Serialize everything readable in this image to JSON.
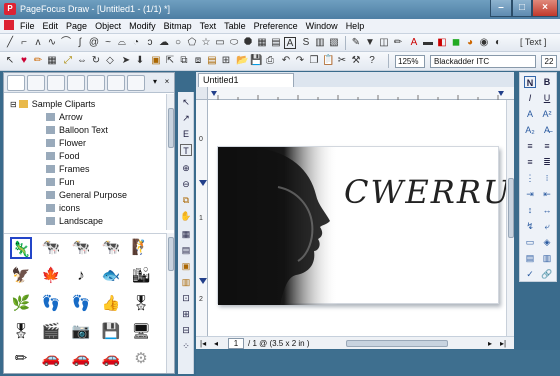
{
  "window": {
    "title": "PageFocus Draw - [Untitled1 - (1/1) *]",
    "min": "–",
    "max": "□",
    "close": "×"
  },
  "menu": [
    "File",
    "Edit",
    "Page",
    "Object",
    "Modify",
    "Bitmap",
    "Text",
    "Table",
    "Preference",
    "Window",
    "Help"
  ],
  "toolbar1": {
    "text_label": "[ Text ]"
  },
  "toolbar2": {
    "zoom": "125%",
    "font": "Blackadder ITC",
    "font_size": "22"
  },
  "library": {
    "root": "Sample Cliparts",
    "items": [
      "Arrow",
      "Balloon Text",
      "Flower",
      "Food",
      "Frames",
      "Fun",
      "General Purpose",
      "icons",
      "Landscape"
    ]
  },
  "clips": [
    "🦎",
    "🐄",
    "🐄",
    "🐄",
    "🧗",
    "🦅",
    "🍁",
    "♪",
    "🐟",
    "🏙",
    "🌿",
    "👣",
    "👣",
    "👍",
    "🎖",
    "🎖",
    "🎬",
    "📷",
    "💾",
    "🖥",
    "✏",
    "🚗",
    "🚗",
    "🚗",
    "⚙"
  ],
  "document": {
    "tab": "Untitled1",
    "title": "CWERRU",
    "page": "1",
    "page_info": "/ 1 @ (3.5 x 2 in )"
  },
  "ruler": {
    "v": [
      "0",
      "1",
      "2"
    ]
  },
  "colors": {
    "accent": "#3366aa",
    "close_red": "#c0392b"
  }
}
